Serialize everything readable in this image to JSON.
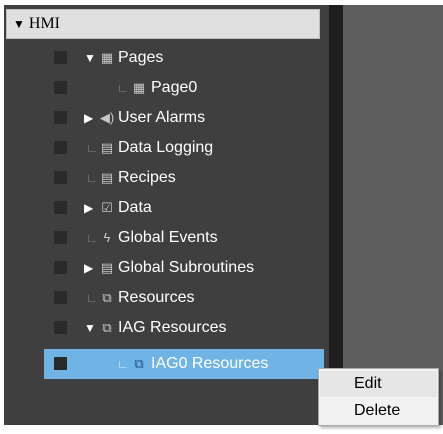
{
  "tree": {
    "root": {
      "expander": "▼",
      "label": "HMI"
    },
    "items": [
      {
        "expander": "▼",
        "connector": "",
        "icon": "▦",
        "icon_name": "pages-icon",
        "label": "Pages"
      },
      {
        "expander": "",
        "connector": "∟",
        "icon": "▦",
        "icon_name": "page-icon",
        "label": "Page0"
      },
      {
        "expander": "▶",
        "connector": "",
        "icon": "◀)",
        "icon_name": "alarm-speaker-icon",
        "label": "User Alarms"
      },
      {
        "expander": "",
        "connector": "∟",
        "icon": "▤",
        "icon_name": "data-logging-icon",
        "label": "Data Logging"
      },
      {
        "expander": "",
        "connector": "∟",
        "icon": "▤",
        "icon_name": "recipes-icon",
        "label": "Recipes"
      },
      {
        "expander": "▶",
        "connector": "",
        "icon": "☑",
        "icon_name": "data-icon",
        "label": "Data"
      },
      {
        "expander": "",
        "connector": "∟",
        "icon": "ϟ",
        "icon_name": "lightning-icon",
        "label": "Global Events"
      },
      {
        "expander": "▶",
        "connector": "",
        "icon": "▤",
        "icon_name": "subroutine-icon",
        "label": "Global Subroutines"
      },
      {
        "expander": "",
        "connector": "∟",
        "icon": "⧉",
        "icon_name": "resources-icon",
        "label": "Resources"
      },
      {
        "expander": "▼",
        "connector": "",
        "icon": "⧉",
        "icon_name": "iag-resources-icon",
        "label": "IAG Resources"
      },
      {
        "expander": "",
        "connector": "∟",
        "icon": "⧉",
        "icon_name": "iag0-resources-icon",
        "label": "IAG0 Resources"
      }
    ]
  },
  "context_menu": {
    "items": [
      {
        "label": "Edit"
      },
      {
        "label": "Delete"
      }
    ]
  },
  "colors": {
    "selection": "#6fb4e4",
    "tree_background": "#3f3f3f"
  }
}
